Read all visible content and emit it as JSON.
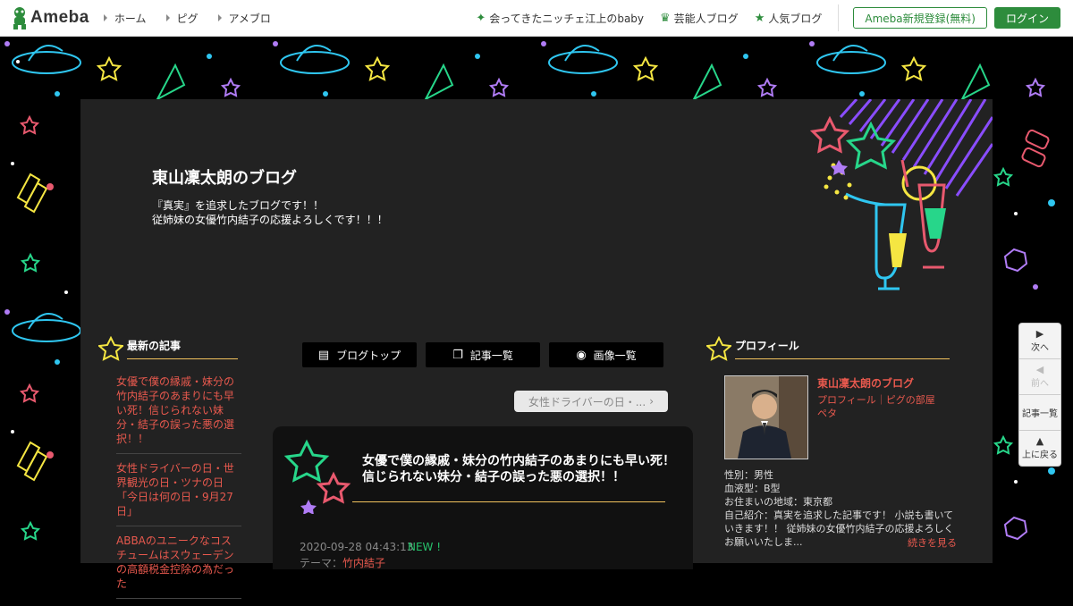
{
  "topbar": {
    "logo": "Ameba",
    "nav": [
      "ホーム",
      "ピグ",
      "アメブロ"
    ],
    "links": [
      {
        "label": "会ってきたニッチェ江上のbaby",
        "icon": "sparkle-icon"
      },
      {
        "label": "芸能人ブログ",
        "icon": "crown-icon"
      },
      {
        "label": "人気ブログ",
        "icon": "star-icon"
      }
    ],
    "register": "Ameba新規登録(無料)",
    "login": "ログイン"
  },
  "blog": {
    "title": "東山凜太朗のブログ",
    "desc_line1": "『真実』を追求したブログです！！",
    "desc_line2": "従姉妹の女優竹内結子の応援よろしくです！！！"
  },
  "sidebar": {
    "heading": "最新の記事",
    "items": [
      "女優で僕の縁戚・妹分の竹内結子のあまりにも早い死！信じられない妹分・結子の誤った悪の選択！！",
      "女性ドライバーの日・世界観光の日・ツナの日「今日は何の日・9月27日」",
      "ABBAのユニークなコスチュームはスウェーデンの高額税金控除の為だった"
    ]
  },
  "menu": {
    "top": "ブログトップ",
    "list": "記事一覧",
    "images": "画像一覧"
  },
  "next_post": "女性ドライバーの日・...",
  "article": {
    "title": "女優で僕の縁戚・妹分の竹内結子のあまりにも早い死！信じられない妹分・結子の誤った悪の選択！！",
    "date": "2020-09-28 04:43:13",
    "new_badge": "NEW !",
    "theme_label": "テーマ：",
    "theme": "竹内結子"
  },
  "profile": {
    "heading": "プロフィール",
    "name": "東山凜太朗のブログ",
    "link_profile": "プロフィール",
    "link_room": "ピグの部屋",
    "link_peta": "ペタ",
    "gender": "性別：男性",
    "blood": "血液型：B型",
    "location": "お住まいの地域：東京都",
    "intro": "自己紹介：真実を追求した記事です！ 小説も書いていきます！！ 従姉妹の女優竹内結子の応援よろしくお願いいたしま...",
    "more": "続きを見る"
  },
  "float_nav": {
    "next": "次へ",
    "prev": "前へ",
    "list": "記事一覧",
    "top": "上に戻る"
  }
}
